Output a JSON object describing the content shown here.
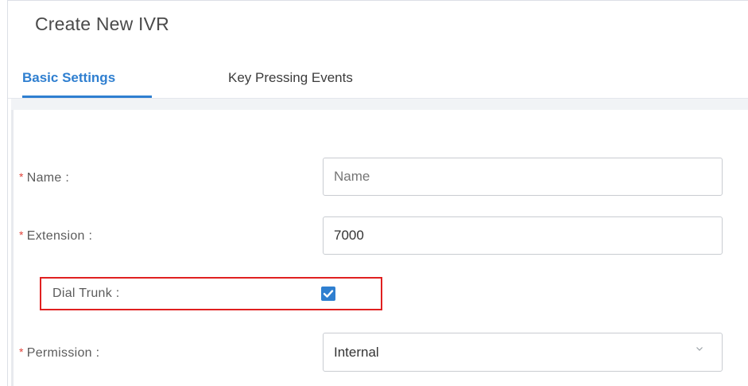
{
  "page": {
    "title": "Create New IVR"
  },
  "tabs": [
    {
      "label": "Basic Settings",
      "active": true
    },
    {
      "label": "Key Pressing Events",
      "active": false
    }
  ],
  "form": {
    "name": {
      "label": "Name :",
      "required": true,
      "required_mark": "*",
      "placeholder": "Name",
      "value": ""
    },
    "extension": {
      "label": "Extension :",
      "required": true,
      "required_mark": "*",
      "value": "7000"
    },
    "dial_trunk": {
      "label": "Dial Trunk :",
      "required": false,
      "checked": true
    },
    "permission": {
      "label": "Permission :",
      "required": true,
      "required_mark": "*",
      "value": "Internal"
    }
  },
  "colors": {
    "accent": "#2f7fd0",
    "required": "#e0433a",
    "highlight": "#e02020"
  },
  "icons": {
    "checkbox": "check-icon",
    "select": "chevron-down-icon"
  }
}
